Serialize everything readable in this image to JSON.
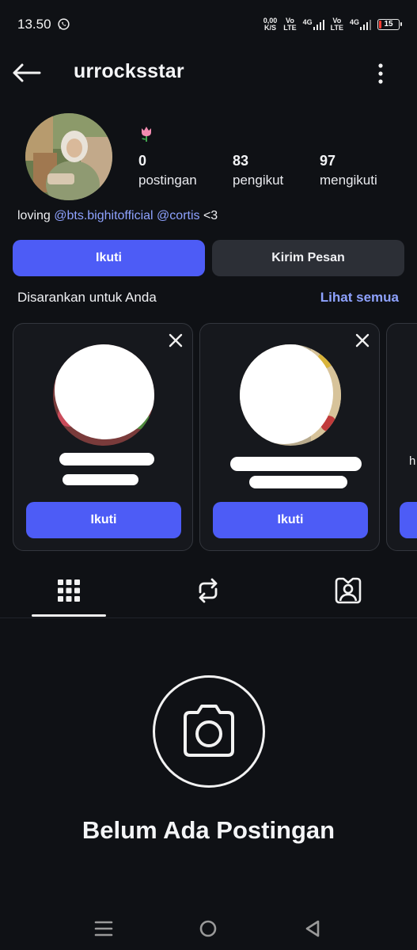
{
  "status_bar": {
    "time": "13.50",
    "speed_value": "0,00",
    "speed_unit": "K/S",
    "sim1_top": "Vo",
    "sim1_bottom": "LTE",
    "net1": "4G",
    "sim2_top": "Vo",
    "sim2_bottom": "LTE",
    "net2": "4G",
    "battery": "15"
  },
  "header": {
    "username": "urrocksstar"
  },
  "profile": {
    "stats": [
      {
        "value": "0",
        "label": "postingan"
      },
      {
        "value": "83",
        "label": "pengikut"
      },
      {
        "value": "97",
        "label": "mengikuti"
      }
    ],
    "bio": {
      "prefix": "loving ",
      "mention1": "@bts.bighitofficial",
      "mention2": "@cortis",
      "suffix": " <3"
    }
  },
  "actions": {
    "follow": "Ikuti",
    "message": "Kirim Pesan"
  },
  "suggestions": {
    "title": "Disarankan untuk Anda",
    "see_all": "Lihat semua",
    "cards": [
      {
        "follow_label": "Ikuti"
      },
      {
        "follow_label": "Ikuti"
      },
      {
        "name_fragment": "h"
      }
    ]
  },
  "empty_state": {
    "title": "Belum Ada Postingan"
  },
  "colors": {
    "accent": "#4d5cf6",
    "link": "#8ea2ff",
    "background": "#0f1115"
  }
}
